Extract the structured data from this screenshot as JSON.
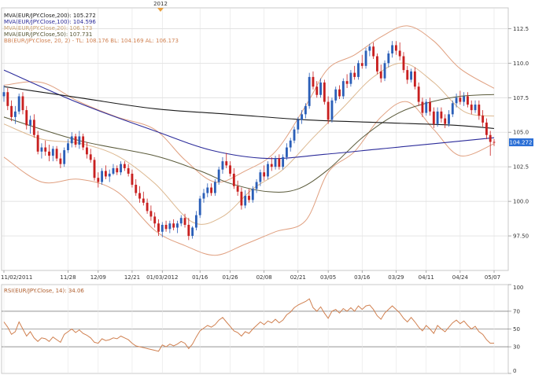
{
  "chart_data": [
    {
      "type": "candlestick",
      "top_label": "2012",
      "legend": [
        {
          "text": "MVA(EUR/JPY.Close,200): 105.272",
          "color": "#1a1a1a"
        },
        {
          "text": "MVA(EUR/JPY.Close,100): 104.596",
          "color": "#2b2b9a"
        },
        {
          "text": "MVA(EUR/JPY.Close,20): 106.173",
          "color": "#c8a070"
        },
        {
          "text": "MVA(EUR/JPY.Close,50): 107.731",
          "color": "#555533"
        },
        {
          "text": "BB(EUR/JPY.Close, 20, 2) - TL: 108.176  BL: 104.169  AL: 106.173",
          "color": "#d08050"
        }
      ],
      "price_badge": "104.272",
      "ylim": [
        95,
        114
      ],
      "y_ticks": [
        "97.50",
        "100.0",
        "102.5",
        "105.0",
        "107.5",
        "110.0",
        "112.5"
      ],
      "y_tick_values": [
        97.5,
        100,
        102.5,
        105,
        107.5,
        110,
        112.5
      ],
      "x_ticks": [
        "11/02/2011",
        "11/28",
        "12/09",
        "12/21",
        "01/03/2012",
        "01/16",
        "01/26",
        "02/08",
        "02/21",
        "03/05",
        "03/16",
        "03/29",
        "04/11",
        "04/24",
        "05/07"
      ],
      "x_tick_index": [
        0,
        17,
        25,
        34,
        42,
        52,
        60,
        69,
        78,
        86,
        95,
        104,
        112,
        121,
        130
      ],
      "candles": [
        [
          107.6,
          108.4,
          107.2,
          107.9
        ],
        [
          107.9,
          108.2,
          106.6,
          106.9
        ],
        [
          106.9,
          107.3,
          105.8,
          106.1
        ],
        [
          106.1,
          106.9,
          105.6,
          106.5
        ],
        [
          106.5,
          107.8,
          106.3,
          107.6
        ],
        [
          107.6,
          107.9,
          106.3,
          106.6
        ],
        [
          106.6,
          106.9,
          105.2,
          105.5
        ],
        [
          105.5,
          106.2,
          104.9,
          105.9
        ],
        [
          105.9,
          106.3,
          104.6,
          104.8
        ],
        [
          104.8,
          105.1,
          103.4,
          103.6
        ],
        [
          103.6,
          104.2,
          103.1,
          103.9
        ],
        [
          103.9,
          104.4,
          103.3,
          103.6
        ],
        [
          103.6,
          104.1,
          102.9,
          103.3
        ],
        [
          103.3,
          104.0,
          102.9,
          103.8
        ],
        [
          103.8,
          104.0,
          102.9,
          103.1
        ],
        [
          103.1,
          103.5,
          102.4,
          102.7
        ],
        [
          102.7,
          103.9,
          102.5,
          103.7
        ],
        [
          103.7,
          104.5,
          103.5,
          104.2
        ],
        [
          104.2,
          105.0,
          103.9,
          104.7
        ],
        [
          104.7,
          104.9,
          103.9,
          104.1
        ],
        [
          104.1,
          105.1,
          103.8,
          104.7
        ],
        [
          104.7,
          104.9,
          103.7,
          103.9
        ],
        [
          103.9,
          104.3,
          103.1,
          103.4
        ],
        [
          103.4,
          103.8,
          102.8,
          103.0
        ],
        [
          103.0,
          103.2,
          101.5,
          101.7
        ],
        [
          101.7,
          102.1,
          101.0,
          101.4
        ],
        [
          101.4,
          102.4,
          101.2,
          102.2
        ],
        [
          102.2,
          102.6,
          101.6,
          101.8
        ],
        [
          101.8,
          102.3,
          101.4,
          102.0
        ],
        [
          102.0,
          102.7,
          101.9,
          102.4
        ],
        [
          102.4,
          102.6,
          101.9,
          102.1
        ],
        [
          102.1,
          102.9,
          101.9,
          102.7
        ],
        [
          102.7,
          102.9,
          102.2,
          102.4
        ],
        [
          102.4,
          102.7,
          101.8,
          102.0
        ],
        [
          102.0,
          102.3,
          101.0,
          101.2
        ],
        [
          101.2,
          101.6,
          100.4,
          100.6
        ],
        [
          100.6,
          101.1,
          99.9,
          100.2
        ],
        [
          100.2,
          100.7,
          99.7,
          99.9
        ],
        [
          99.9,
          100.2,
          99.1,
          99.3
        ],
        [
          99.3,
          99.7,
          98.6,
          98.9
        ],
        [
          98.9,
          99.2,
          98.1,
          98.4
        ],
        [
          98.4,
          98.7,
          97.5,
          97.8
        ],
        [
          97.8,
          98.5,
          97.4,
          98.3
        ],
        [
          98.3,
          98.6,
          97.8,
          98.0
        ],
        [
          98.0,
          98.6,
          97.7,
          98.4
        ],
        [
          98.4,
          98.7,
          97.9,
          98.1
        ],
        [
          98.1,
          98.6,
          97.7,
          98.4
        ],
        [
          98.4,
          99.0,
          98.2,
          98.8
        ],
        [
          98.8,
          99.1,
          98.1,
          98.3
        ],
        [
          98.3,
          98.8,
          97.2,
          97.5
        ],
        [
          97.5,
          98.2,
          97.3,
          98.1
        ],
        [
          98.1,
          99.3,
          97.9,
          99.0
        ],
        [
          99.0,
          100.4,
          98.8,
          100.2
        ],
        [
          100.2,
          100.9,
          99.9,
          100.6
        ],
        [
          100.6,
          101.3,
          100.3,
          101.0
        ],
        [
          101.0,
          101.3,
          100.4,
          100.6
        ],
        [
          100.6,
          101.6,
          100.4,
          101.4
        ],
        [
          101.4,
          102.5,
          101.2,
          102.3
        ],
        [
          102.3,
          103.2,
          102.0,
          102.9
        ],
        [
          102.9,
          103.5,
          102.4,
          102.6
        ],
        [
          102.6,
          102.9,
          101.8,
          102.0
        ],
        [
          102.0,
          102.4,
          100.9,
          101.1
        ],
        [
          101.1,
          101.5,
          100.4,
          100.7
        ],
        [
          100.7,
          101.0,
          99.4,
          99.7
        ],
        [
          99.7,
          100.8,
          99.5,
          100.4
        ],
        [
          100.4,
          100.9,
          99.9,
          100.1
        ],
        [
          100.1,
          101.1,
          99.9,
          100.9
        ],
        [
          100.9,
          101.6,
          100.6,
          101.4
        ],
        [
          101.4,
          102.3,
          101.1,
          102.1
        ],
        [
          102.1,
          102.6,
          101.5,
          101.8
        ],
        [
          101.8,
          102.9,
          101.6,
          102.7
        ],
        [
          102.7,
          103.2,
          102.2,
          102.5
        ],
        [
          102.5,
          103.3,
          102.3,
          103.1
        ],
        [
          103.1,
          103.4,
          102.3,
          102.5
        ],
        [
          102.5,
          103.4,
          102.3,
          103.2
        ],
        [
          103.2,
          104.2,
          103.0,
          103.9
        ],
        [
          103.9,
          104.6,
          103.6,
          104.4
        ],
        [
          104.4,
          105.4,
          104.2,
          105.2
        ],
        [
          105.2,
          106.1,
          104.9,
          105.9
        ],
        [
          105.9,
          106.6,
          105.6,
          106.3
        ],
        [
          106.3,
          107.1,
          106.0,
          106.9
        ],
        [
          106.9,
          109.3,
          106.7,
          109.0
        ],
        [
          109.0,
          109.4,
          108.1,
          108.3
        ],
        [
          108.3,
          108.7,
          107.5,
          107.7
        ],
        [
          107.7,
          108.9,
          107.5,
          108.6
        ],
        [
          108.6,
          108.8,
          107.0,
          107.2
        ],
        [
          107.2,
          107.6,
          105.6,
          105.9
        ],
        [
          105.9,
          107.5,
          105.7,
          107.3
        ],
        [
          107.3,
          108.3,
          107.1,
          108.1
        ],
        [
          108.1,
          108.4,
          107.4,
          107.6
        ],
        [
          107.6,
          108.9,
          107.4,
          108.7
        ],
        [
          108.7,
          109.2,
          108.2,
          108.5
        ],
        [
          108.5,
          109.5,
          108.3,
          109.3
        ],
        [
          109.3,
          109.8,
          108.8,
          109.0
        ],
        [
          109.0,
          110.2,
          108.8,
          110.0
        ],
        [
          110.0,
          110.6,
          109.6,
          109.8
        ],
        [
          109.8,
          111.1,
          109.6,
          110.9
        ],
        [
          110.9,
          111.4,
          110.5,
          111.2
        ],
        [
          111.2,
          111.5,
          110.3,
          110.5
        ],
        [
          110.5,
          110.7,
          109.2,
          109.4
        ],
        [
          109.4,
          109.9,
          108.6,
          108.9
        ],
        [
          108.9,
          110.2,
          108.7,
          110.0
        ],
        [
          110.0,
          110.9,
          109.7,
          110.7
        ],
        [
          110.7,
          111.6,
          110.4,
          111.3
        ],
        [
          111.3,
          111.6,
          110.6,
          110.9
        ],
        [
          110.9,
          111.5,
          110.2,
          110.5
        ],
        [
          110.5,
          110.8,
          109.3,
          109.5
        ],
        [
          109.5,
          109.8,
          108.5,
          108.8
        ],
        [
          108.8,
          109.6,
          108.6,
          109.4
        ],
        [
          109.4,
          109.7,
          108.1,
          108.3
        ],
        [
          108.3,
          108.6,
          106.9,
          107.2
        ],
        [
          107.2,
          107.5,
          106.1,
          106.4
        ],
        [
          106.4,
          107.4,
          106.2,
          107.2
        ],
        [
          107.2,
          107.5,
          106.2,
          106.5
        ],
        [
          106.5,
          106.8,
          105.3,
          105.6
        ],
        [
          105.6,
          106.8,
          105.4,
          106.5
        ],
        [
          106.5,
          106.8,
          105.7,
          106.0
        ],
        [
          106.0,
          106.3,
          105.3,
          105.6
        ],
        [
          105.6,
          106.6,
          105.4,
          106.3
        ],
        [
          106.3,
          107.3,
          106.1,
          107.1
        ],
        [
          107.1,
          107.8,
          106.8,
          107.5
        ],
        [
          107.5,
          108.0,
          107.0,
          107.2
        ],
        [
          107.2,
          107.9,
          106.9,
          107.6
        ],
        [
          107.6,
          107.9,
          106.8,
          107.0
        ],
        [
          107.0,
          107.3,
          106.3,
          106.6
        ],
        [
          106.6,
          107.3,
          106.4,
          107.0
        ],
        [
          107.0,
          107.3,
          105.9,
          106.2
        ],
        [
          106.2,
          106.6,
          105.4,
          105.7
        ],
        [
          105.7,
          106.0,
          104.5,
          104.8
        ],
        [
          104.8,
          105.1,
          103.3,
          104.3
        ],
        [
          104.3,
          104.5,
          104.0,
          104.27
        ]
      ],
      "ma200": [
        [
          0,
          108.3
        ],
        [
          20,
          107.5
        ],
        [
          40,
          106.7
        ],
        [
          60,
          106.3
        ],
        [
          80,
          105.9
        ],
        [
          100,
          105.7
        ],
        [
          120,
          105.5
        ],
        [
          130,
          105.27
        ]
      ],
      "ma100": [
        [
          0,
          109.5
        ],
        [
          20,
          107.1
        ],
        [
          40,
          105.1
        ],
        [
          55,
          103.7
        ],
        [
          70,
          103.1
        ],
        [
          85,
          103.4
        ],
        [
          100,
          103.8
        ],
        [
          115,
          104.2
        ],
        [
          130,
          104.6
        ]
      ],
      "ma50": [
        [
          0,
          106.1
        ],
        [
          20,
          104.4
        ],
        [
          40,
          103.3
        ],
        [
          52,
          102.2
        ],
        [
          60,
          101.3
        ],
        [
          70,
          100.7
        ],
        [
          78,
          100.9
        ],
        [
          86,
          102.3
        ],
        [
          95,
          104.6
        ],
        [
          104,
          106.3
        ],
        [
          112,
          107.1
        ],
        [
          121,
          107.6
        ],
        [
          130,
          107.73
        ]
      ],
      "ma20": [
        [
          0,
          105.6
        ],
        [
          10,
          104.5
        ],
        [
          20,
          104.2
        ],
        [
          30,
          103.3
        ],
        [
          40,
          101.3
        ],
        [
          50,
          98.5
        ],
        [
          58,
          98.9
        ],
        [
          66,
          100.9
        ],
        [
          74,
          102.3
        ],
        [
          82,
          104.6
        ],
        [
          90,
          106.8
        ],
        [
          98,
          109.0
        ],
        [
          106,
          110.0
        ],
        [
          114,
          108.6
        ],
        [
          122,
          106.5
        ],
        [
          130,
          106.17
        ]
      ],
      "bb_upper": [
        [
          0,
          108.4
        ],
        [
          10,
          108.6
        ],
        [
          20,
          107.2
        ],
        [
          30,
          106.1
        ],
        [
          40,
          105.2
        ],
        [
          48,
          103.0
        ],
        [
          56,
          101.4
        ],
        [
          64,
          102.2
        ],
        [
          72,
          103.6
        ],
        [
          80,
          106.9
        ],
        [
          86,
          109.6
        ],
        [
          93,
          110.6
        ],
        [
          100,
          111.9
        ],
        [
          107,
          112.7
        ],
        [
          114,
          111.6
        ],
        [
          121,
          109.6
        ],
        [
          130,
          108.18
        ]
      ],
      "bb_lower": [
        [
          0,
          103.2
        ],
        [
          10,
          101.4
        ],
        [
          20,
          101.6
        ],
        [
          30,
          100.7
        ],
        [
          40,
          97.9
        ],
        [
          48,
          96.8
        ],
        [
          56,
          96.1
        ],
        [
          64,
          96.9
        ],
        [
          72,
          97.8
        ],
        [
          80,
          98.6
        ],
        [
          86,
          102.1
        ],
        [
          93,
          103.6
        ],
        [
          100,
          106.1
        ],
        [
          107,
          107.2
        ],
        [
          114,
          105.2
        ],
        [
          121,
          103.3
        ],
        [
          130,
          104.17
        ]
      ],
      "rsi_label": "RSI(EUR/JPY.Close, 14): 34.06",
      "rsi_ylim": [
        0,
        100
      ],
      "rsi_ticks": [
        "0",
        "30",
        "50",
        "70",
        "100"
      ],
      "rsi_tick_values": [
        0,
        30,
        50,
        70,
        100
      ],
      "rsi_values": [
        58,
        52,
        44,
        47,
        58,
        50,
        42,
        47,
        40,
        36,
        40,
        39,
        36,
        41,
        38,
        35,
        44,
        47,
        50,
        46,
        49,
        45,
        43,
        40,
        35,
        34,
        39,
        37,
        38,
        40,
        39,
        42,
        40,
        38,
        34,
        31,
        30,
        29,
        28,
        27,
        26,
        25,
        32,
        30,
        33,
        31,
        33,
        36,
        34,
        28,
        33,
        41,
        48,
        51,
        54,
        52,
        55,
        60,
        63,
        58,
        53,
        48,
        46,
        42,
        47,
        45,
        50,
        54,
        58,
        55,
        59,
        57,
        61,
        57,
        60,
        66,
        69,
        74,
        77,
        79,
        81,
        84,
        74,
        70,
        75,
        68,
        62,
        70,
        72,
        68,
        73,
        70,
        74,
        70,
        76,
        72,
        76,
        77,
        72,
        65,
        61,
        68,
        72,
        76,
        72,
        68,
        62,
        58,
        63,
        58,
        52,
        48,
        54,
        50,
        45,
        54,
        50,
        47,
        52,
        57,
        60,
        56,
        59,
        54,
        50,
        53,
        47,
        44,
        38,
        34,
        34.06
      ]
    }
  ]
}
